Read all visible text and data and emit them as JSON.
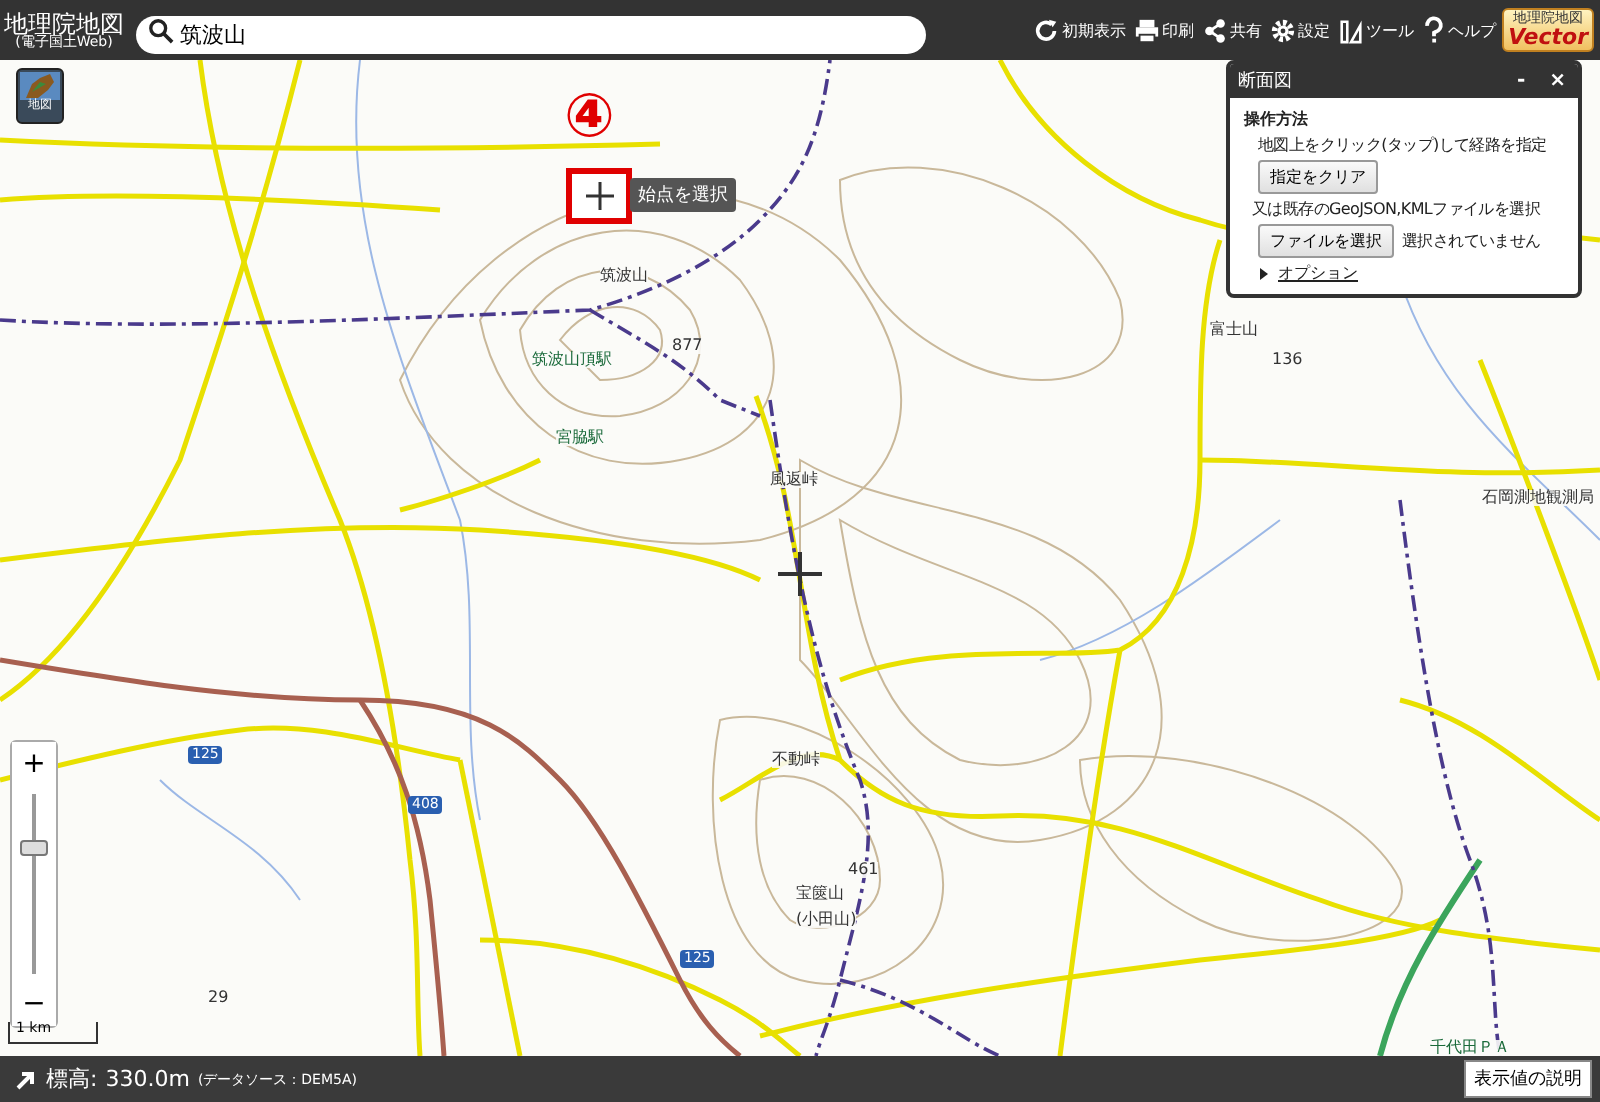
{
  "header": {
    "title": "地理院地図",
    "subtitle": "(電子国土Web)",
    "search": {
      "value": "筑波山"
    },
    "tools": [
      {
        "kind": "reset",
        "label": "初期表示"
      },
      {
        "kind": "print",
        "label": "印刷"
      },
      {
        "kind": "share",
        "label": "共有"
      },
      {
        "kind": "settings",
        "label": "設定"
      },
      {
        "kind": "tool",
        "label": "ツール"
      },
      {
        "kind": "help",
        "label": "ヘルプ"
      }
    ],
    "logo": {
      "top": "地理院地図",
      "bottom": "Vector"
    }
  },
  "layer_button": {
    "label": "地図"
  },
  "map_labels": [
    {
      "kind": "place",
      "text": "筑波山"
    },
    {
      "kind": "peak",
      "text": "877"
    },
    {
      "kind": "station",
      "text": "筑波山頂駅"
    },
    {
      "kind": "station",
      "text": "宮脇駅"
    },
    {
      "kind": "place",
      "text": "風返峠"
    },
    {
      "kind": "place",
      "text": "不動峠"
    },
    {
      "kind": "peak",
      "text": "461"
    },
    {
      "kind": "place",
      "text": "宝篋山"
    },
    {
      "kind": "place",
      "text": "(小田山)"
    },
    {
      "kind": "place",
      "text": "富士山"
    },
    {
      "kind": "peak",
      "text": "136"
    },
    {
      "kind": "facility",
      "text": "石岡測地観測局"
    },
    {
      "kind": "station",
      "text": "千代田ＰＡ"
    },
    {
      "kind": "peak",
      "text": "29"
    },
    {
      "kind": "route",
      "text": "125"
    },
    {
      "kind": "route",
      "text": "408"
    },
    {
      "kind": "route",
      "text": "125"
    }
  ],
  "step_marker": {
    "label": "④"
  },
  "start_point": {
    "tooltip": "始点を選択"
  },
  "profile_panel": {
    "title": "断面図",
    "minimize": "-",
    "close": "×",
    "heading": "操作方法",
    "instruction": "地図上をクリック(タップ)して経路を指定",
    "clear_button": "指定をクリア",
    "file_instruction": "又は既存のGeoJSON,KMLファイルを選択",
    "file_button": "ファイルを選択",
    "file_status": "選択されていません",
    "options": {
      "label": "オプション",
      "expanded": false
    }
  },
  "zoom": {
    "plus": "+",
    "minus": "−",
    "level": 0.7
  },
  "scale": {
    "label": "1 km"
  },
  "status_bar": {
    "elevation_label": "標高:",
    "elevation": "330.0m",
    "source": "(データソース：DEM5A)",
    "help_button": "表示値の説明"
  }
}
